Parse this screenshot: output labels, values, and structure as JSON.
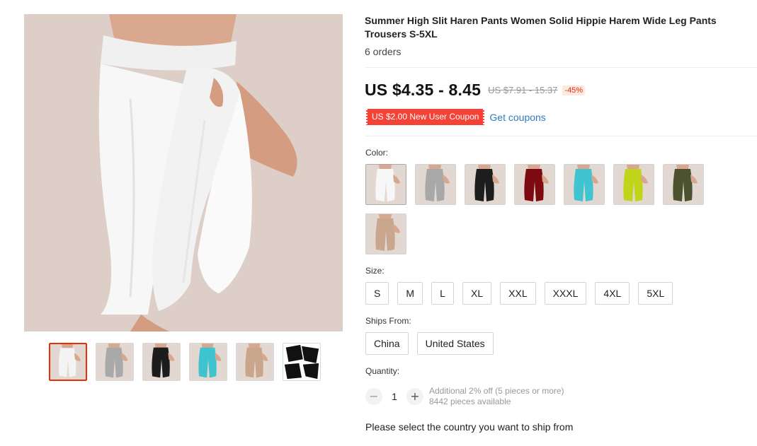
{
  "product": {
    "title": "Summer High Slit Haren Pants Women Solid Hippie Harem Wide Leg Pants Trousers S-5XL",
    "orders": "6 orders",
    "price": "US $4.35 - 8.45",
    "original_price": "US $7.91 - 15.37",
    "discount": "-45%",
    "coupon": "US $2.00 New User Coupon",
    "get_coupons": "Get coupons",
    "accent_color": "#e62e04",
    "coupon_color": "#f44336",
    "link_color": "#2f7cc0"
  },
  "gallery": {
    "main_image_color": "white",
    "thumbnails": [
      {
        "color_name": "white",
        "hex": "#f4f4f4"
      },
      {
        "color_name": "gray",
        "hex": "#a9a9a9"
      },
      {
        "color_name": "black",
        "hex": "#1c1c1c"
      },
      {
        "color_name": "turquoise",
        "hex": "#3fc3cf"
      },
      {
        "color_name": "khaki",
        "hex": "#c9a58b"
      },
      {
        "color_name": "detail",
        "hex": "#111111"
      }
    ]
  },
  "color_section": {
    "label": "Color:",
    "swatches": [
      {
        "name": "white",
        "hex": "#f7f7f7"
      },
      {
        "name": "gray",
        "hex": "#a8a8a8"
      },
      {
        "name": "black",
        "hex": "#1d1d1d"
      },
      {
        "name": "burgundy",
        "hex": "#7d0a10"
      },
      {
        "name": "turquoise",
        "hex": "#40c4d0"
      },
      {
        "name": "lime",
        "hex": "#c0d41a"
      },
      {
        "name": "olive",
        "hex": "#4c5230"
      },
      {
        "name": "khaki",
        "hex": "#c9a78e"
      }
    ]
  },
  "size_section": {
    "label": "Size:",
    "sizes": [
      "S",
      "M",
      "L",
      "XL",
      "XXL",
      "XXXL",
      "4XL",
      "5XL"
    ]
  },
  "ships_section": {
    "label": "Ships From:",
    "options": [
      "China",
      "United States"
    ]
  },
  "quantity_section": {
    "label": "Quantity:",
    "minus": "−",
    "plus": "+",
    "value": "1",
    "note_discount": "Additional 2% off (5 pieces or more)",
    "note_available": "8442 pieces available"
  },
  "ship_note": "Please select the country you want to ship from"
}
